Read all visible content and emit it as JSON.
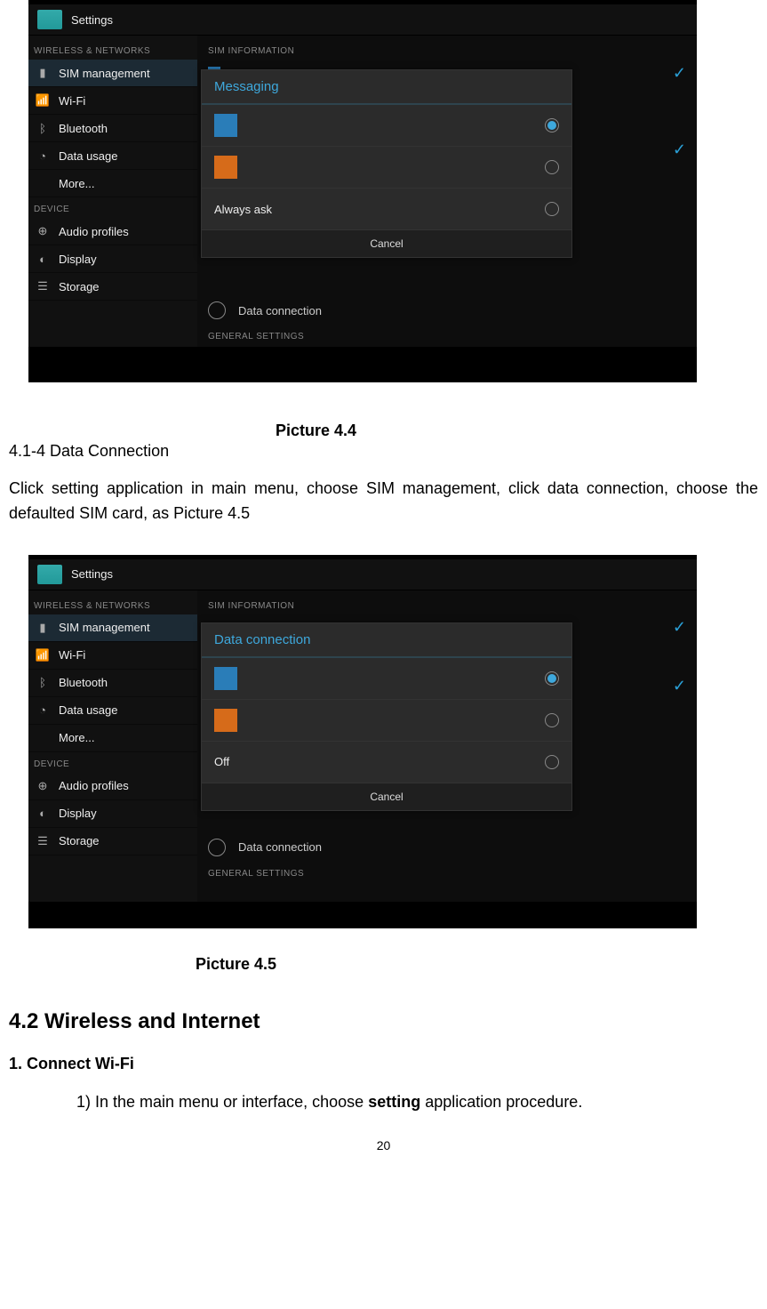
{
  "screenshot1": {
    "settings_title": "Settings",
    "cat_wireless": "WIRELESS & NETWORKS",
    "row_sim": "SIM management",
    "row_wifi": "Wi-Fi",
    "row_bt": "Bluetooth",
    "row_data": "Data usage",
    "row_more": "More...",
    "cat_device": "DEVICE",
    "row_audio": "Audio profiles",
    "row_display": "Display",
    "row_storage": "Storage",
    "right_head_sim": "SIM INFORMATION",
    "right_data_conn": "Data connection",
    "right_gen": "GENERAL SETTINGS",
    "dialog_title": "Messaging",
    "dialog_opt3": "Always ask",
    "dialog_cancel": "Cancel"
  },
  "screenshot2": {
    "settings_title": "Settings",
    "cat_wireless": "WIRELESS & NETWORKS",
    "row_sim": "SIM management",
    "row_wifi": "Wi-Fi",
    "row_bt": "Bluetooth",
    "row_data": "Data usage",
    "row_more": "More...",
    "cat_device": "DEVICE",
    "row_audio": "Audio profiles",
    "row_display": "Display",
    "row_storage": "Storage",
    "right_head_sim": "SIM INFORMATION",
    "right_data_conn": "Data connection",
    "right_gen": "GENERAL SETTINGS",
    "dialog_title": "Data connection",
    "dialog_opt3": "Off",
    "dialog_cancel": "Cancel"
  },
  "doc": {
    "caption44": "Picture 4.4",
    "sub_title": "4.1-4 Data Connection",
    "para1": "Click setting application in main menu, choose SIM management, click data connection, choose the defaulted SIM card, as Picture 4.5",
    "caption45": "Picture 4.5",
    "heading42": "4.2 Wireless and Internet",
    "connect_wifi": "1. Connect Wi-Fi",
    "step1_a": "1) In the main menu or interface, choose ",
    "step1_b": "setting",
    "step1_c": " application procedure.",
    "page_num": "20"
  }
}
